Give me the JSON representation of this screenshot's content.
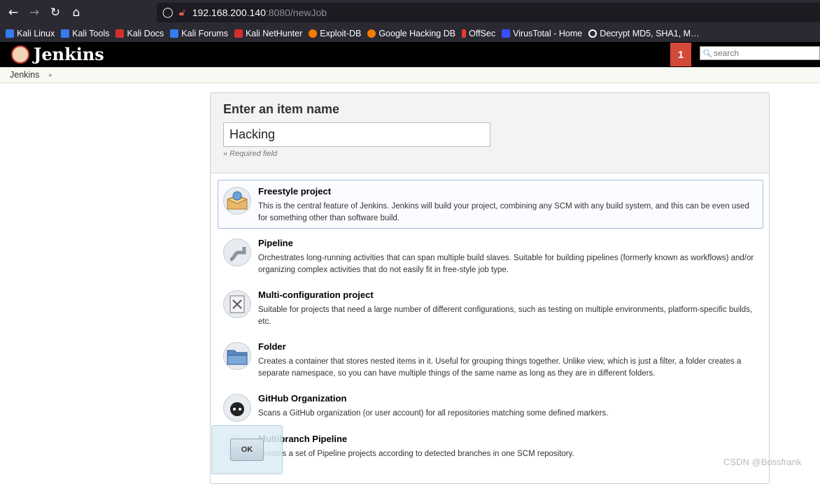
{
  "browser": {
    "address_host": "192.168.200.140",
    "address_rest": ":8080/newJob",
    "bookmarks": [
      {
        "label": "Kali Linux",
        "color": "#367bf0"
      },
      {
        "label": "Kali Tools",
        "color": "#367bf0"
      },
      {
        "label": "Kali Docs",
        "color": "#d32f2f"
      },
      {
        "label": "Kali Forums",
        "color": "#367bf0"
      },
      {
        "label": "Kali NetHunter",
        "color": "#d32f2f"
      },
      {
        "label": "Exploit-DB",
        "color": "#f57c00"
      },
      {
        "label": "Google Hacking DB",
        "color": "#f57c00"
      },
      {
        "label": "OffSec",
        "color": "#e53935"
      },
      {
        "label": "VirusTotal - Home",
        "color": "#394eff"
      },
      {
        "label": "Decrypt MD5, SHA1, M…",
        "color": "#ffffff"
      }
    ]
  },
  "jenkins": {
    "app_name": "Jenkins",
    "notification_count": "1",
    "search_placeholder": "search",
    "breadcrumb": "Jenkins"
  },
  "form": {
    "heading": "Enter an item name",
    "item_name_value": "Hacking",
    "required_note": "» Required field",
    "ok_label": "OK"
  },
  "items": [
    {
      "title": "Freestyle project",
      "desc": "This is the central feature of Jenkins. Jenkins will build your project, combining any SCM with any build system, and this can be even used for something other than software build.",
      "icon": "freestyle-project-icon"
    },
    {
      "title": "Pipeline",
      "desc": "Orchestrates long-running activities that can span multiple build slaves. Suitable for building pipelines (formerly known as workflows) and/or organizing complex activities that do not easily fit in free-style job type.",
      "icon": "pipeline-icon"
    },
    {
      "title": "Multi-configuration project",
      "desc": "Suitable for projects that need a large number of different configurations, such as testing on multiple environments, platform-specific builds, etc.",
      "icon": "multi-configuration-icon"
    },
    {
      "title": "Folder",
      "desc": "Creates a container that stores nested items in it. Useful for grouping things together. Unlike view, which is just a filter, a folder creates a separate namespace, so you can have multiple things of the same name as long as they are in different folders.",
      "icon": "folder-icon"
    },
    {
      "title": "GitHub Organization",
      "desc": "Scans a GitHub organization (or user account) for all repositories matching some defined markers.",
      "icon": "github-organization-icon"
    },
    {
      "title": "Multibranch Pipeline",
      "desc": "Creates a set of Pipeline projects according to detected branches in one SCM repository.",
      "icon": "multibranch-pipeline-icon"
    }
  ],
  "watermark": "CSDN @Bossfrank"
}
